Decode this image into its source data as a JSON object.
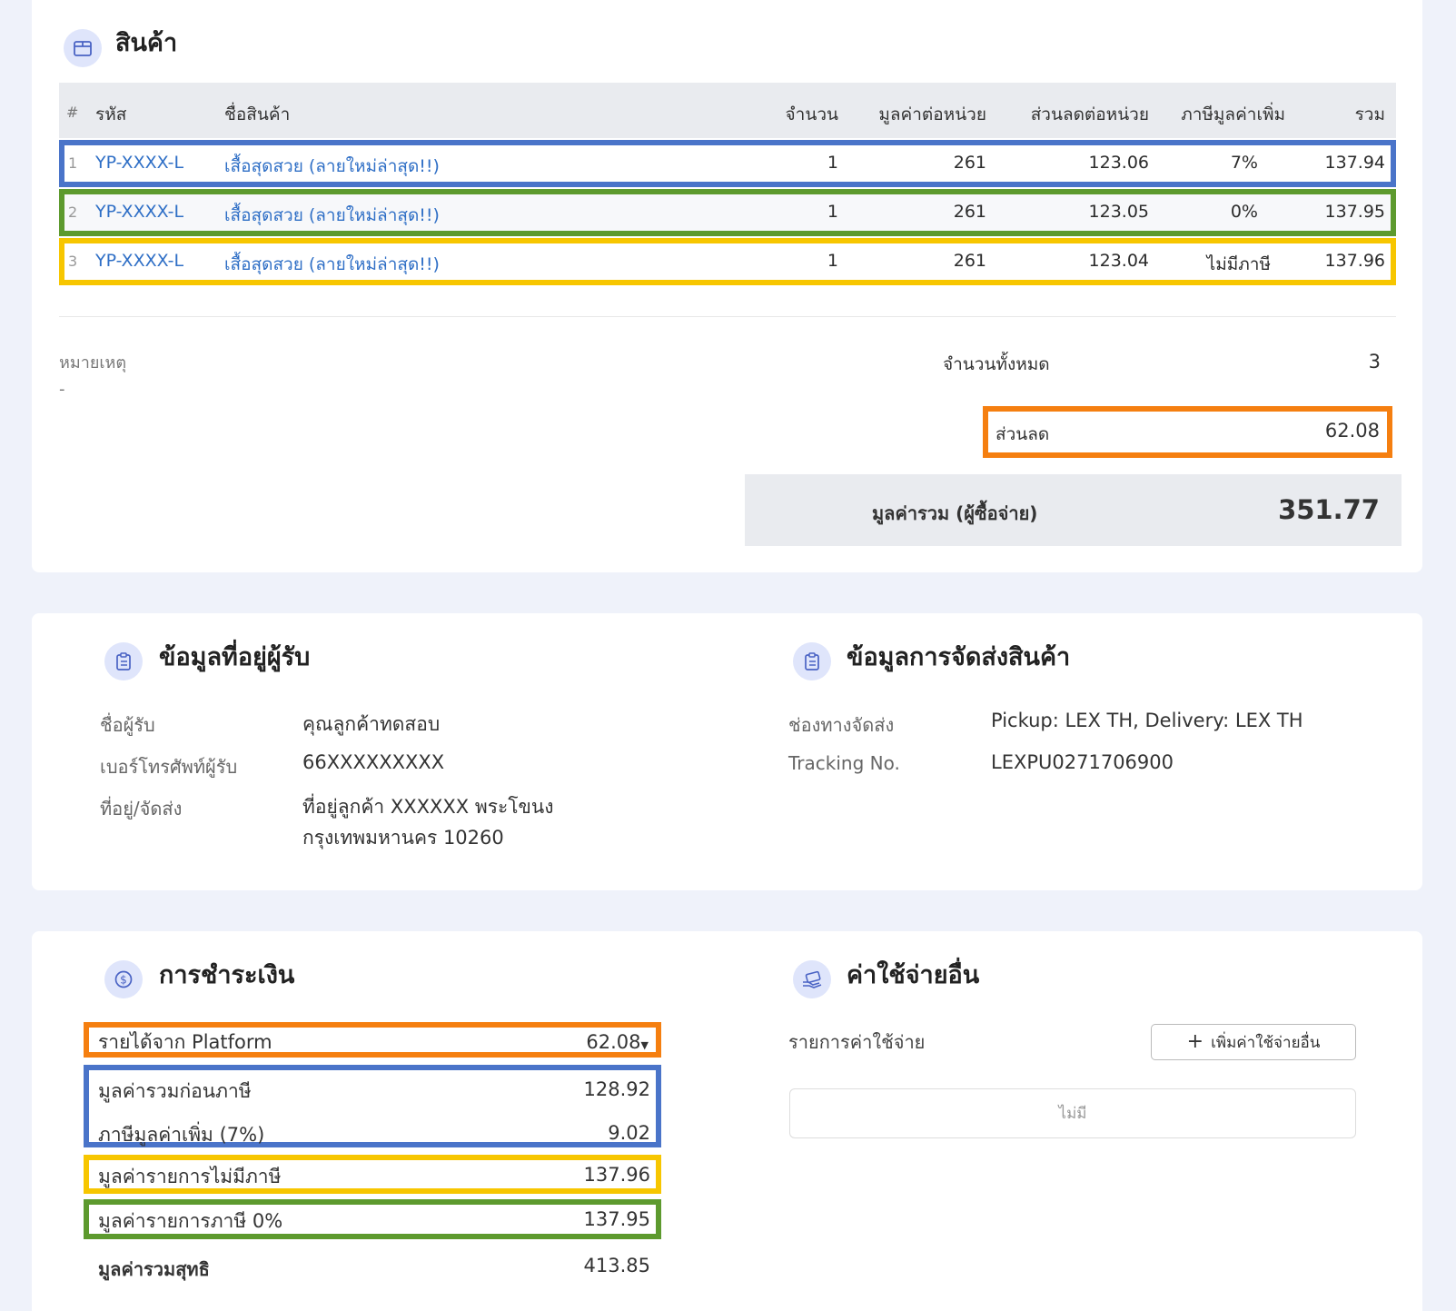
{
  "products": {
    "title": "สินค้า",
    "icon": "box-icon",
    "columns": {
      "idx": "#",
      "sku": "รหัส",
      "name": "ชื่อสินค้า",
      "qty": "จำนวน",
      "unit_price": "มูลค่าต่อหน่วย",
      "unit_discount": "ส่วนลดต่อหน่วย",
      "vat": "ภาษีมูลค่าเพิ่ม",
      "total": "รวม"
    },
    "rows": [
      {
        "idx": "1",
        "sku": "YP-XXXX-L",
        "name": "เสื้อสุดสวย (ลายใหม่ล่าสุด!!)",
        "qty": "1",
        "unit_price": "261",
        "unit_discount": "123.06",
        "vat": "7%",
        "total": "137.94"
      },
      {
        "idx": "2",
        "sku": "YP-XXXX-L",
        "name": "เสื้อสุดสวย (ลายใหม่ล่าสุด!!)",
        "qty": "1",
        "unit_price": "261",
        "unit_discount": "123.05",
        "vat": "0%",
        "total": "137.95"
      },
      {
        "idx": "3",
        "sku": "YP-XXXX-L",
        "name": "เสื้อสุดสวย (ลายใหม่ล่าสุด!!)",
        "qty": "1",
        "unit_price": "261",
        "unit_discount": "123.04",
        "vat": "ไม่มีภาษี",
        "total": "137.96"
      }
    ],
    "note_label": "หมายเหตุ",
    "note_value": "-",
    "total_qty_label": "จำนวนทั้งหมด",
    "total_qty_value": "3",
    "discount_label": "ส่วนลด",
    "discount_value": "62.08",
    "grand_total_label": "มูลค่ารวม (ผู้ซื้อจ่าย)",
    "grand_total_value": "351.77"
  },
  "recipient": {
    "title": "ข้อมูลที่อยู่ผู้รับ",
    "icon": "clipboard-icon",
    "name_label": "ชื่อผู้รับ",
    "name_value": "คุณลูกค้าทดสอบ",
    "phone_label": "เบอร์โทรศัพท์ผู้รับ",
    "phone_value": "66XXXXXXXXX",
    "address_label": "ที่อยู่/จัดส่ง",
    "address_line1": "ที่อยู่ลูกค้า XXXXXX พระโขนง",
    "address_line2": "กรุงเทพมหานคร 10260"
  },
  "shipping": {
    "title": "ข้อมูลการจัดส่งสินค้า",
    "icon": "clipboard-icon",
    "channel_label": "ช่องทางจัดส่ง",
    "channel_value": "Pickup: LEX TH, Delivery: LEX TH",
    "tracking_label": "Tracking No.",
    "tracking_value": "LEXPU0271706900"
  },
  "payment": {
    "title": "การชำระเงิน",
    "icon": "dollar-icon",
    "platform_label": "รายได้จาก Platform",
    "platform_value": "62.08",
    "pre_tax_label": "มูลค่ารวมก่อนภาษี",
    "pre_tax_value": "128.92",
    "vat_label": "ภาษีมูลค่าเพิ่ม (7%)",
    "vat_value": "9.02",
    "no_tax_label": "มูลค่ารายการไม่มีภาษี",
    "no_tax_value": "137.96",
    "zero_tax_label": "มูลค่ารายการภาษี 0%",
    "zero_tax_value": "137.95",
    "net_label": "มูลค่ารวมสุทธิ",
    "net_value": "413.85"
  },
  "other_costs": {
    "title": "ค่าใช้จ่ายอื่น",
    "icon": "money-hand-icon",
    "list_label": "รายการค่าใช้จ่าย",
    "add_button": "เพิ่มค่าใช้จ่ายอื่น",
    "empty_text": "ไม่มี"
  },
  "colors": {
    "link": "#2f6fc6",
    "blue": "#4a74c9",
    "green": "#5d9a2e",
    "yellow": "#f7c600",
    "orange": "#f57f10"
  }
}
